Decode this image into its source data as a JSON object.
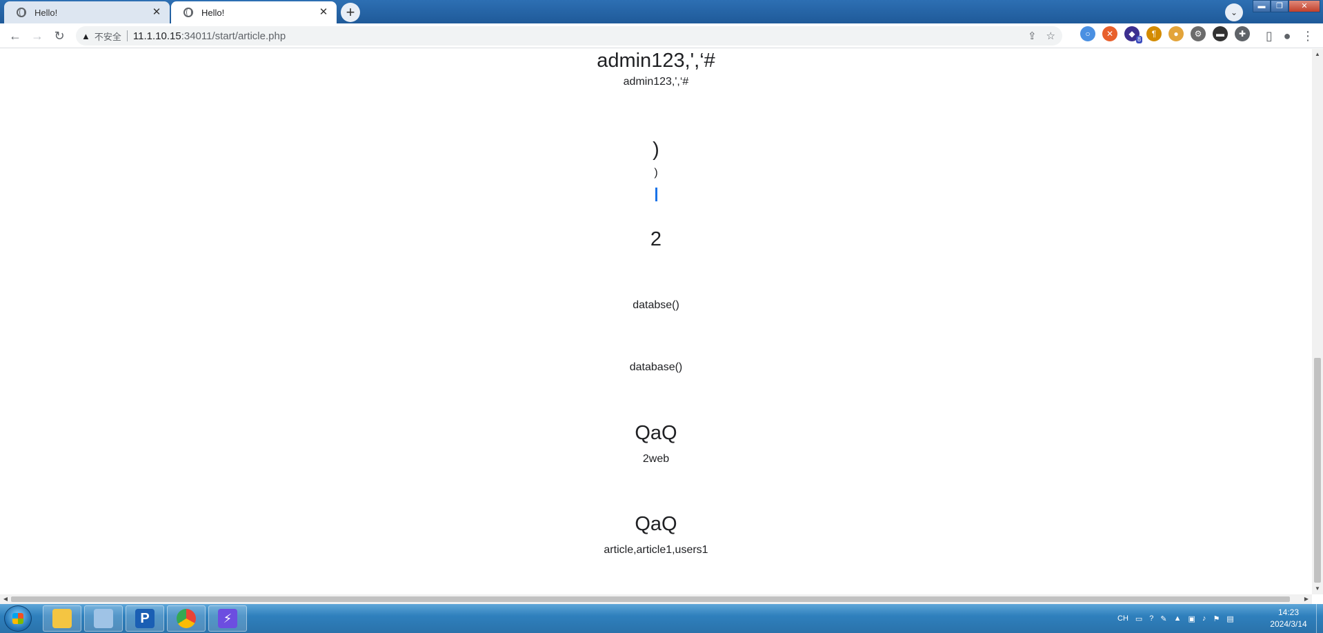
{
  "browser": {
    "tabs": [
      {
        "title": "Hello!",
        "active": false
      },
      {
        "title": "Hello!",
        "active": true
      }
    ],
    "new_tab_label": "+",
    "nav": {
      "back": "←",
      "forward": "→",
      "reload": "↻"
    },
    "address": {
      "security_label": "不安全",
      "url_host": "11.1.10.15",
      "url_rest": ":34011/start/article.php"
    },
    "extensions": [
      {
        "name": "circle-extension-icon",
        "color": "#4a90e2",
        "glyph": "○"
      },
      {
        "name": "orange-extension-icon",
        "color": "#e8602c",
        "glyph": "✕"
      },
      {
        "name": "cube-extension-icon",
        "color": "#3c2f8f",
        "glyph": "◆",
        "badge": "8"
      },
      {
        "name": "pilcrow-extension-icon",
        "color": "#d38b00",
        "glyph": "¶"
      },
      {
        "name": "cookie-extension-icon",
        "color": "#e3a43a",
        "glyph": "●"
      },
      {
        "name": "gear-extension-icon",
        "color": "#6b6b6b",
        "glyph": "⚙"
      },
      {
        "name": "hat-extension-icon",
        "color": "#333333",
        "glyph": "▬"
      },
      {
        "name": "puzzle-extension-icon",
        "color": "#5f6368",
        "glyph": "✚"
      }
    ]
  },
  "page": {
    "entries": [
      {
        "heading": "admin123,',‘#",
        "text": "admin123,',‘#"
      },
      {
        "heading": ")",
        "text": ")"
      },
      {
        "heading": "2",
        "text": ""
      },
      {
        "heading": "",
        "text": "databse()"
      },
      {
        "heading": "",
        "text": "database()"
      },
      {
        "heading": "QaQ",
        "text": "2web"
      },
      {
        "heading": "QaQ",
        "text": "article,article1,users1"
      }
    ]
  },
  "taskbar": {
    "apps": [
      {
        "name": "file-explorer",
        "color": "#f4c542"
      },
      {
        "name": "notepad-app",
        "color": "#9fc3e6"
      },
      {
        "name": "p-app",
        "color": "#1a5fb4"
      },
      {
        "name": "chrome-app",
        "color": "#34a853"
      },
      {
        "name": "bolt-app",
        "color": "#6c4ee0"
      }
    ],
    "tray": {
      "language": "CH"
    },
    "clock": {
      "time": "14:23",
      "date": "2024/3/14"
    }
  },
  "colors": {
    "titlebar": "#2364a8",
    "link_caret": "#1a73e8",
    "taskbar": "#2f80bd"
  }
}
